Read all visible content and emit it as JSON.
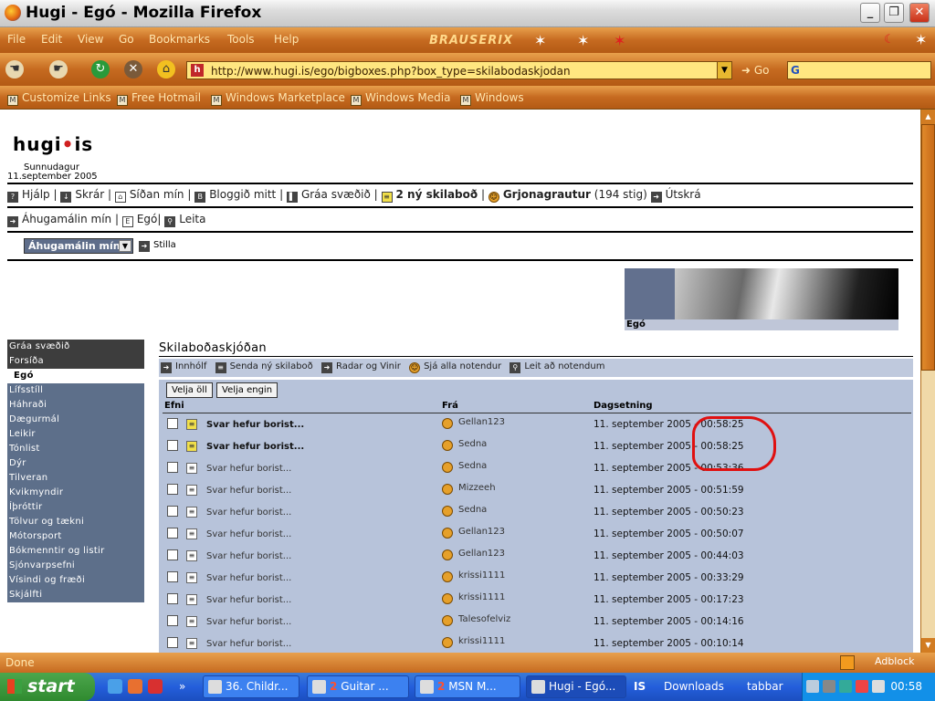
{
  "window": {
    "title": "Hugi - Egó - Mozilla Firefox"
  },
  "menu": [
    "File",
    "Edit",
    "View",
    "Go",
    "Bookmarks",
    "Tools",
    "Help"
  ],
  "brand": "BRAUSERIX",
  "toolbar": {
    "url": "http://www.hugi.is/ego/bigboxes.php?box_type=skilabodaskjodan",
    "go_label": "Go",
    "search_value": "G"
  },
  "links": [
    "Customize Links",
    "Free Hotmail",
    "Windows Marketplace",
    "Windows Media",
    "Windows"
  ],
  "page": {
    "logo_a": "hugi",
    "logo_dot": "•",
    "logo_b": "is",
    "day": "Sunnudagur",
    "date": "11.september 2005",
    "nav1": {
      "help": "Hjálp",
      "files": "Skrár",
      "mypage": "Síðan mín",
      "blog": "Bloggið mitt",
      "grey": "Gráa svæðið",
      "messages": "2 ný skilaboð",
      "user": "Grjonagrautur",
      "points": "(194 stig)",
      "logout": "Útskrá"
    },
    "nav2": {
      "interests": "Áhugamálin mín",
      "ego": "Egó",
      "search": "Leita"
    },
    "select_value": "Áhugamálin mín",
    "stilla": "Stilla",
    "banner_caption": "Egó"
  },
  "sidebar": {
    "top": [
      "Gráa svæðið",
      "Forsíða"
    ],
    "current": "Egó",
    "categories": [
      "Lífsstíll",
      "Háhraði",
      "Dægurmál",
      "Leikir",
      "Tónlist",
      "Dýr",
      "Tilveran",
      "Kvikmyndir",
      "Íþróttir",
      "Tölvur og tækni",
      "Mótorsport",
      "Bókmenntir og listir",
      "Sjónvarpsefni",
      "Vísindi og fræði",
      "Skjálfti"
    ]
  },
  "main": {
    "title": "Skilaboðaskjóðan",
    "subnav": [
      "Innhólf",
      "Senda ný skilaboð",
      "Radar og Vinir",
      "Sjá alla notendur",
      "Leit að notendum"
    ],
    "select_all": "Velja öll",
    "select_none": "Velja engin",
    "columns": {
      "subject": "Efni",
      "from": "Frá",
      "date": "Dagsetning"
    },
    "messages": [
      {
        "subject": "Svar hefur borist...",
        "from": "Gellan123",
        "date": "11. september 2005 - 00:58:25",
        "unread": true
      },
      {
        "subject": "Svar hefur borist...",
        "from": "Sedna",
        "date": "11. september 2005 - 00:58:25",
        "unread": true
      },
      {
        "subject": "Svar hefur borist...",
        "from": "Sedna",
        "date": "11. september 2005 - 00:53:36",
        "unread": false
      },
      {
        "subject": "Svar hefur borist...",
        "from": "Mizzeeh",
        "date": "11. september 2005 - 00:51:59",
        "unread": false
      },
      {
        "subject": "Svar hefur borist...",
        "from": "Sedna",
        "date": "11. september 2005 - 00:50:23",
        "unread": false
      },
      {
        "subject": "Svar hefur borist...",
        "from": "Gellan123",
        "date": "11. september 2005 - 00:50:07",
        "unread": false
      },
      {
        "subject": "Svar hefur borist...",
        "from": "Gellan123",
        "date": "11. september 2005 - 00:44:03",
        "unread": false
      },
      {
        "subject": "Svar hefur borist...",
        "from": "krissi1111",
        "date": "11. september 2005 - 00:33:29",
        "unread": false
      },
      {
        "subject": "Svar hefur borist...",
        "from": "krissi1111",
        "date": "11. september 2005 - 00:17:23",
        "unread": false
      },
      {
        "subject": "Svar hefur borist...",
        "from": "Talesofelviz",
        "date": "11. september 2005 - 00:14:16",
        "unread": false
      },
      {
        "subject": "Svar hefur borist...",
        "from": "krissi1111",
        "date": "11. september 2005 - 00:10:14",
        "unread": false
      }
    ]
  },
  "status": {
    "text": "Done",
    "adblock": "Adblock"
  },
  "taskbar": {
    "start": "start",
    "tasks": [
      {
        "label": "36. Childr...",
        "count": ""
      },
      {
        "label": "Guitar ...",
        "count": "2"
      },
      {
        "label": "MSN M...",
        "count": "2"
      },
      {
        "label": "Hugi - Egó...",
        "count": ""
      }
    ],
    "items": [
      "IS",
      "Downloads",
      "tabbar"
    ],
    "clock": "00:58"
  },
  "colors": {
    "chrome_orange": "#c66a20",
    "sidebar_blue": "#5d6f8a",
    "list_bg": "#b7c3da",
    "annotation_red": "#e01010"
  }
}
